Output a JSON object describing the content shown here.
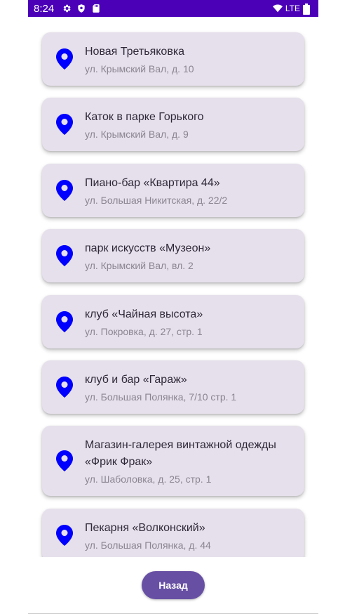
{
  "status_bar": {
    "time": "8:24",
    "network": "LTE",
    "icons": [
      "gear-icon",
      "shield-icon",
      "sd-card-icon",
      "wifi-icon",
      "battery-icon"
    ]
  },
  "places": [
    {
      "title": "Новая Третьяковка",
      "address": "ул. Крымский Вал, д. 10"
    },
    {
      "title": "Каток в парке Горького",
      "address": "ул. Крымский Вал, д. 9"
    },
    {
      "title": "Пиано-бар «Квартира 44»",
      "address": "ул. Большая Никитская, д. 22/2"
    },
    {
      "title": "парк искусств «Музеон»",
      "address": "ул. Крымский Вал, вл. 2"
    },
    {
      "title": "клуб «Чайная высота»",
      "address": "ул. Покровка, д. 27, стр. 1"
    },
    {
      "title": "клуб и бар «Гараж»",
      "address": "ул. Большая Полянка, 7/10 стр. 1"
    },
    {
      "title": "Магазин-галерея винтажной одежды «Фрик Фрак»",
      "address": "ул. Шаболовка, д. 25, стр. 1"
    },
    {
      "title": "Пекарня «Волконский»",
      "address": "ул. Большая Полянка, д. 44"
    }
  ],
  "back_button": {
    "label": "Назад"
  },
  "colors": {
    "status_bar": "#4b00b8",
    "card": "#e6e0ec",
    "pin": "#0000ff",
    "button": "#6750a4"
  }
}
